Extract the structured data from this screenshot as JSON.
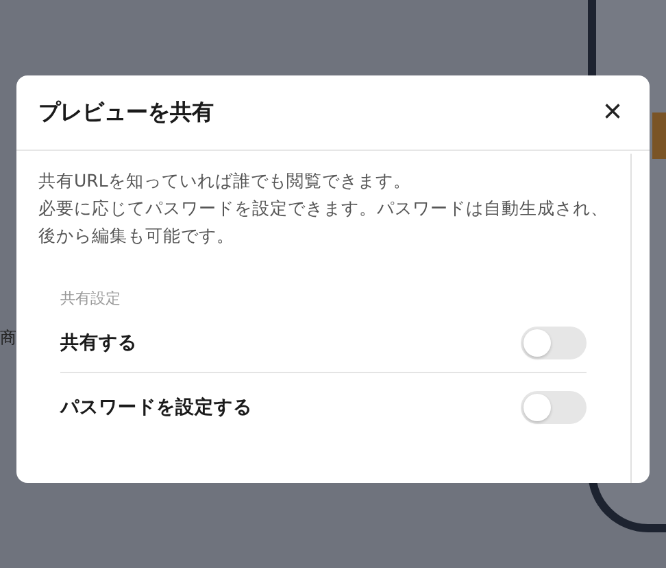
{
  "background": {
    "partial_text": "商"
  },
  "dialog": {
    "title": "プレビューを共有",
    "close_label": "×",
    "description": [
      "共有URLを知っていれば誰でも閲覧できます。",
      "必要に応じてパスワードを設定できます。パスワードは自動生成され、後から編集も可能です。"
    ],
    "section_label": "共有設定",
    "settings": [
      {
        "label": "共有する",
        "checked": false
      },
      {
        "label": "パスワードを設定する",
        "checked": false
      }
    ]
  }
}
